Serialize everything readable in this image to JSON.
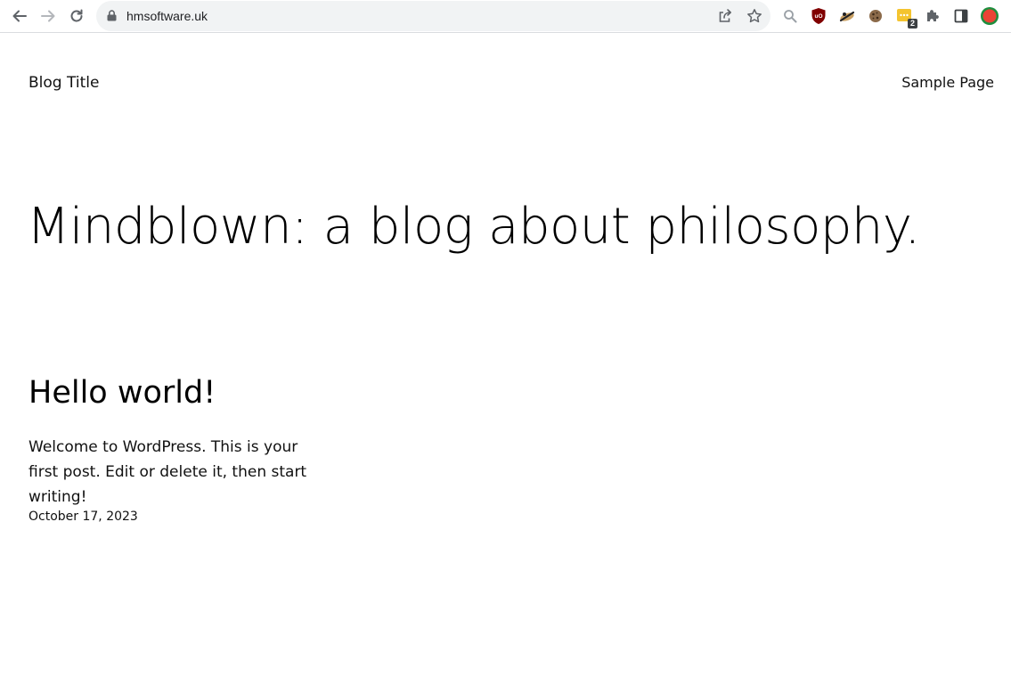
{
  "browser": {
    "url": "hmsoftware.uk",
    "extension_badge_count": "2",
    "icons": {
      "back": "back-arrow-icon",
      "forward": "forward-arrow-icon",
      "reload": "reload-icon",
      "lock": "lock-icon",
      "share": "share-icon",
      "bookmark": "star-icon",
      "search": "search-icon",
      "ublock": "ublock-shield-icon",
      "extension_2": "extension-icon",
      "extension_3": "cookie-icon",
      "extension_4": "chat-extension-icon",
      "extensions_menu": "puzzle-icon",
      "side_panel": "side-panel-icon",
      "profile": "profile-avatar-icon"
    }
  },
  "site": {
    "title": "Blog Title",
    "nav": [
      "Sample Page"
    ],
    "tagline": "Mindblown: a blog about philosophy."
  },
  "posts": [
    {
      "title": "Hello world!",
      "excerpt": "Welcome to WordPress. This is your first post. Edit or delete it, then start writing!",
      "date": "October 17, 2023"
    }
  ],
  "colors": {
    "omnibox_bg": "#f1f3f4",
    "text": "#111111",
    "ublock_red": "#800000",
    "profile_green": "#1e8e3e",
    "profile_red": "#ea4335",
    "badge_yellow": "#f4c430"
  }
}
